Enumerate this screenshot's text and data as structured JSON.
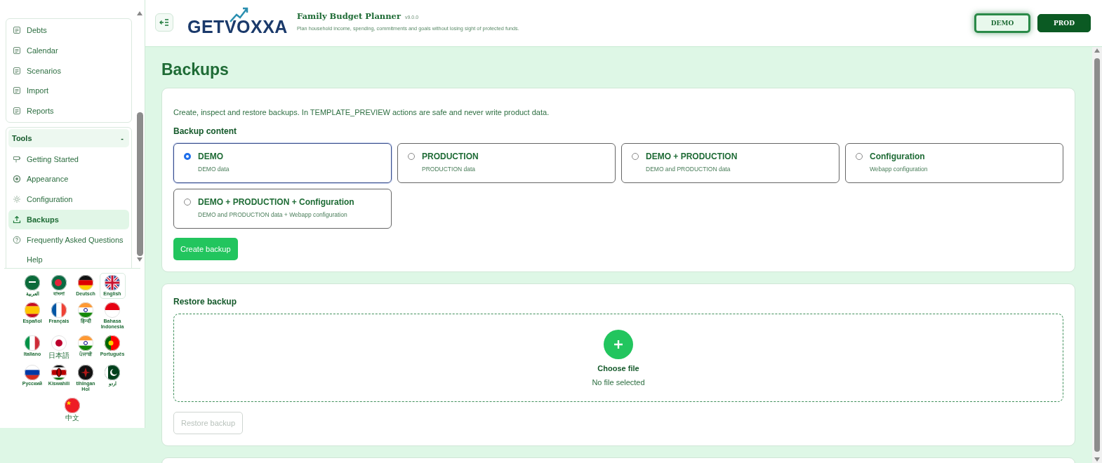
{
  "sidebar": {
    "nav_items": [
      {
        "label": "Debts",
        "selected": false
      },
      {
        "label": "Calendar",
        "selected": false
      },
      {
        "label": "Scenarios",
        "selected": false
      },
      {
        "label": "Import",
        "selected": false
      },
      {
        "label": "Reports",
        "selected": false
      }
    ],
    "tools": {
      "title": "Tools",
      "toggle": "-",
      "expanded": true,
      "items": [
        {
          "label": "Getting Started",
          "selected": false
        },
        {
          "label": "Appearance",
          "selected": false
        },
        {
          "label": "Configuration",
          "selected": false
        },
        {
          "label": "Backups",
          "selected": true
        },
        {
          "label": "Frequently Asked Questions",
          "selected": false
        },
        {
          "label": "Help",
          "selected": false
        }
      ]
    },
    "languages": [
      {
        "label": "العربية",
        "selected": false
      },
      {
        "label": "বাংলা",
        "selected": false
      },
      {
        "label": "Deutsch",
        "selected": false
      },
      {
        "label": "English",
        "selected": true
      },
      {
        "label": "Español",
        "selected": false
      },
      {
        "label": "Français",
        "selected": false
      },
      {
        "label": "हिन्दी",
        "selected": false
      },
      {
        "label": "Bahasa Indonesia",
        "selected": false
      },
      {
        "label": "Italiano",
        "selected": false
      },
      {
        "label": "日本語",
        "selected": false
      },
      {
        "label": "ਪੰਜਾਬੀ",
        "selected": false
      },
      {
        "label": "Português",
        "selected": false
      },
      {
        "label": "Русский",
        "selected": false
      },
      {
        "label": "Kiswahili",
        "selected": false
      },
      {
        "label": "tlhIngan Hol",
        "selected": false
      },
      {
        "label": "اردو",
        "selected": false
      },
      {
        "label": "中文",
        "selected": false
      }
    ]
  },
  "header": {
    "logo": "GETVOXXA",
    "title": "Family Budget Planner",
    "version": "v9.0.0",
    "subtitle": "Plan household income, spending, commitments and goals without losing sight of protected funds.",
    "modes": [
      {
        "label": "DEMO",
        "selected": true
      },
      {
        "label": "PROD",
        "selected": false
      }
    ]
  },
  "page": {
    "title": "Backups",
    "backup_card": {
      "intro": "Create, inspect and restore backups. In TEMPLATE_PREVIEW actions are safe and never write product data.",
      "heading": "Backup content",
      "options": [
        {
          "title": "DEMO",
          "description": "DEMO data",
          "selected": true
        },
        {
          "title": "PRODUCTION",
          "description": "PRODUCTION data",
          "selected": false
        },
        {
          "title": "DEMO + PRODUCTION",
          "description": "DEMO and PRODUCTION data",
          "selected": false
        },
        {
          "title": "Configuration",
          "description": "Webapp configuration",
          "selected": false
        },
        {
          "title": "DEMO + PRODUCTION + Configuration",
          "description": "DEMO and PRODUCTION data + Webapp configuration",
          "selected": false
        }
      ],
      "button": {
        "label": "Create backup",
        "disabled": false
      }
    },
    "restore_card": {
      "heading": "Restore backup",
      "drop_label": "Choose file",
      "file_status": "No file selected",
      "button": {
        "label": "Restore backup",
        "disabled": true
      }
    }
  }
}
